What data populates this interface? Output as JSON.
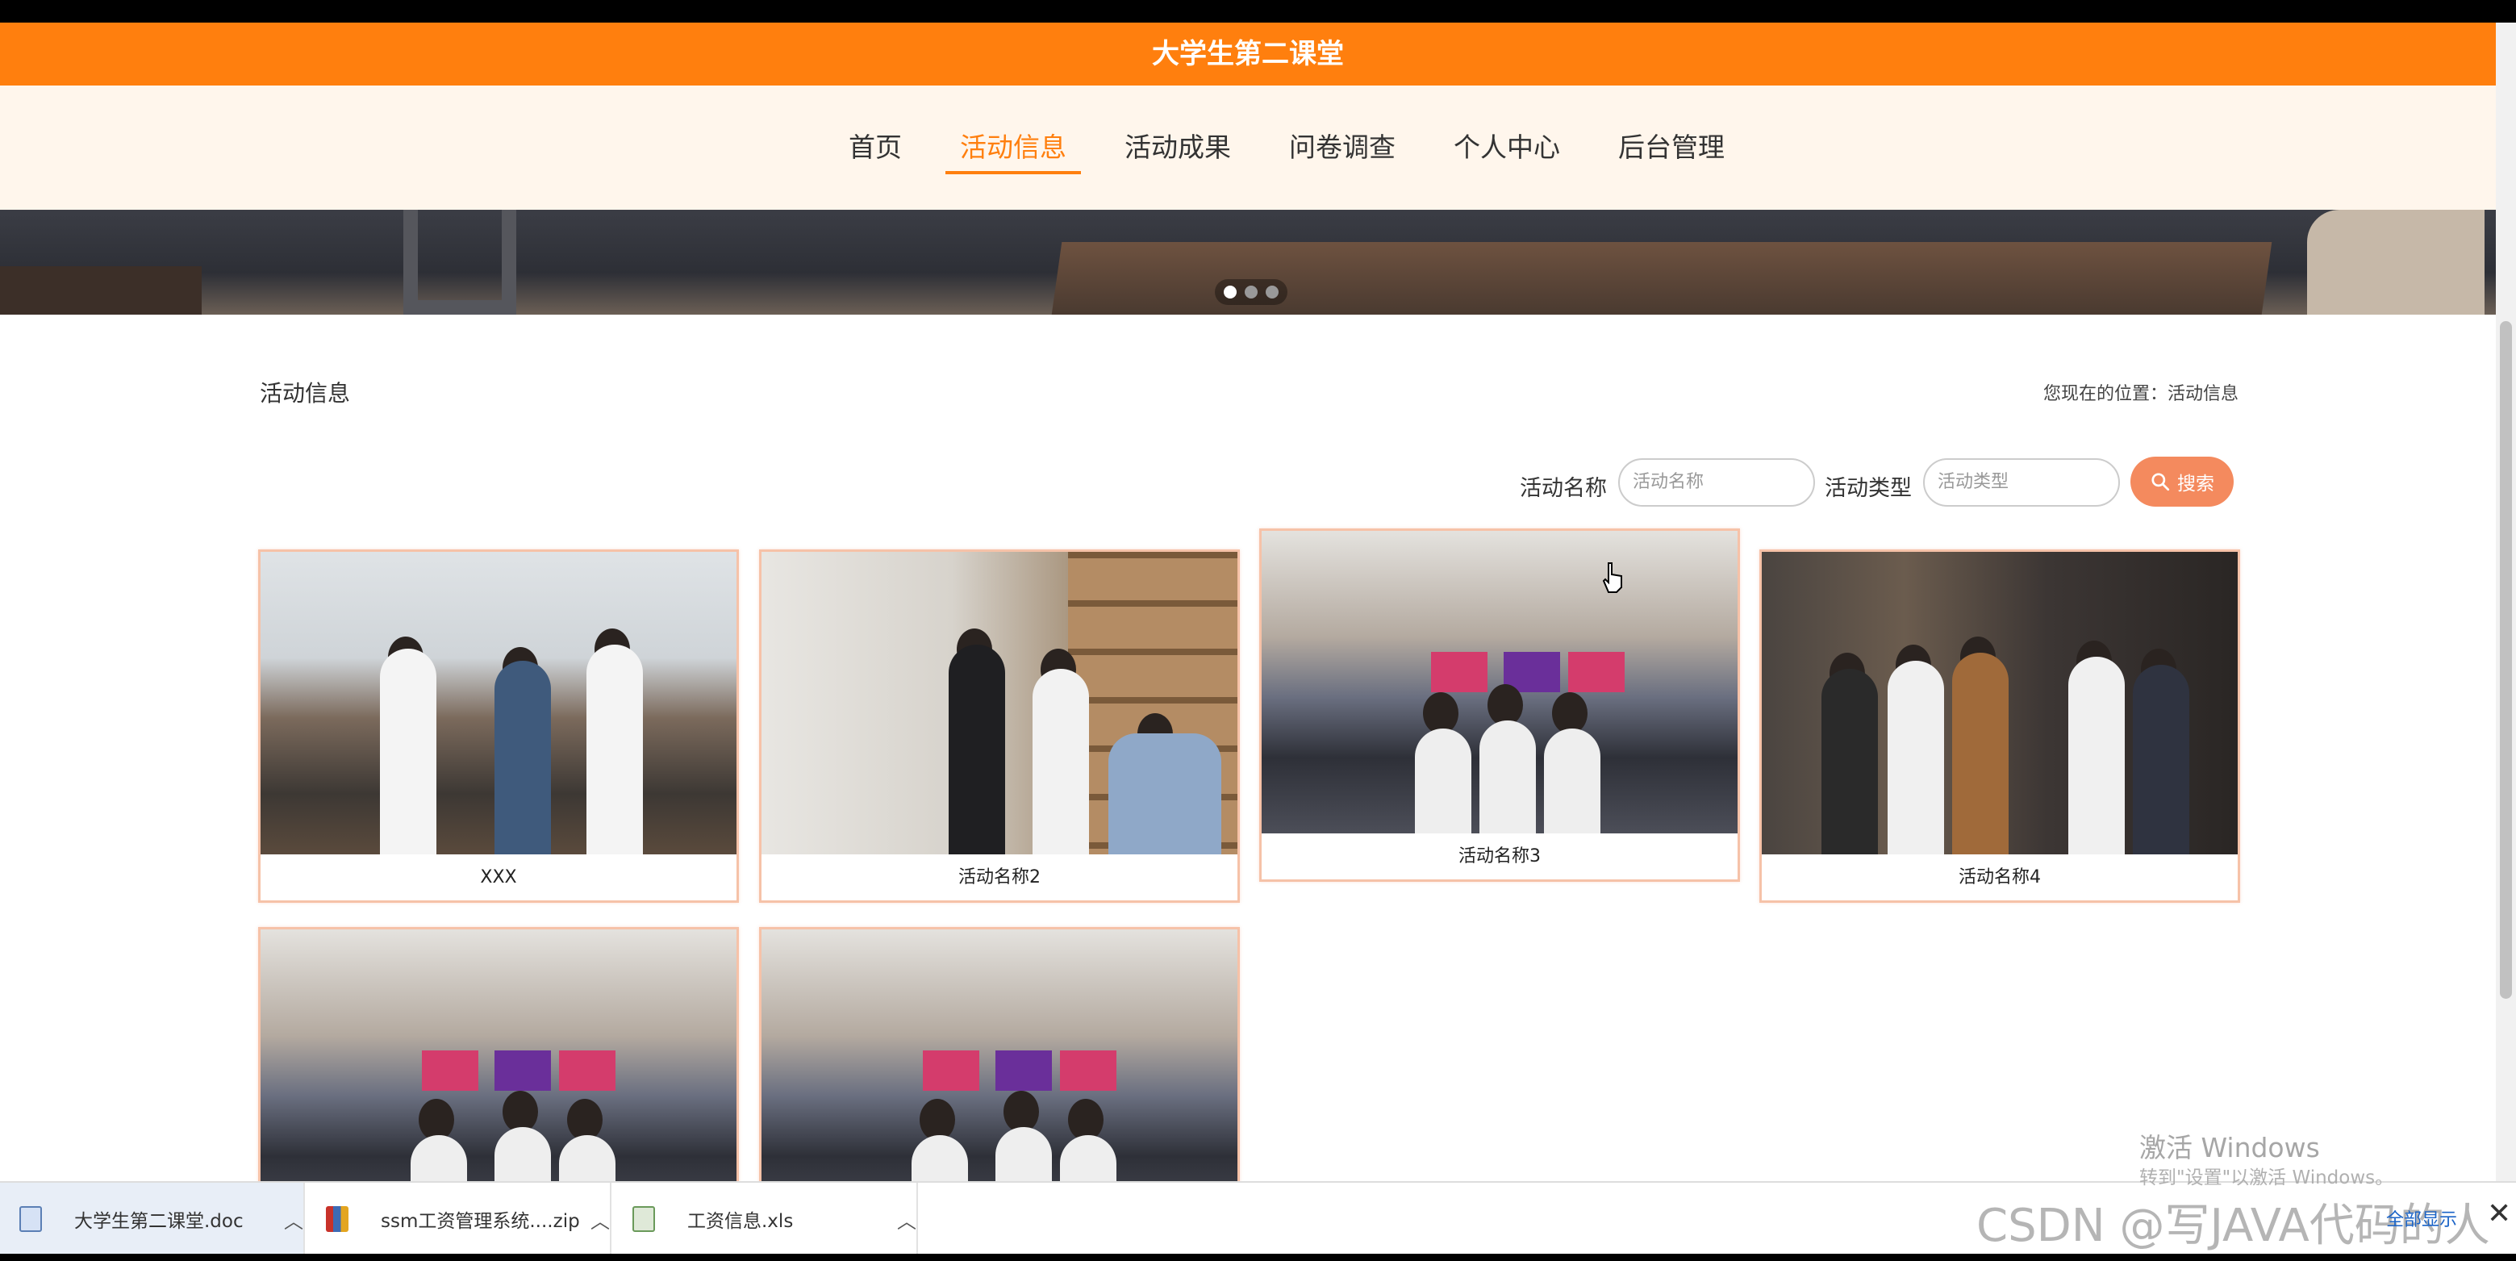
{
  "site": {
    "title": "大学生第二课堂"
  },
  "nav": {
    "items": [
      "首页",
      "活动信息",
      "活动成果",
      "问卷调查",
      "个人中心",
      "后台管理"
    ],
    "active_index": 1
  },
  "banner": {
    "slides": 3,
    "active_slide": 0
  },
  "section": {
    "title": "活动信息",
    "breadcrumb": "您现在的位置：活动信息"
  },
  "search": {
    "name_label": "活动名称",
    "name_placeholder": "活动名称",
    "type_label": "活动类型",
    "type_placeholder": "活动类型",
    "button_label": "搜索"
  },
  "cards": [
    {
      "title": "XXX"
    },
    {
      "title": "活动名称2"
    },
    {
      "title": "活动名称3"
    },
    {
      "title": "活动名称4"
    },
    {
      "title": ""
    },
    {
      "title": ""
    }
  ],
  "downloads": [
    {
      "name": "大学生第二课堂.doc",
      "icon": "doc-icon"
    },
    {
      "name": "ssm工资管理系统....zip",
      "icon": "zip-icon"
    },
    {
      "name": "工资信息.xls",
      "icon": "xls-icon"
    }
  ],
  "downloads_bar": {
    "show_all": "全部显示"
  },
  "overlay": {
    "activate_title": "激活 Windows",
    "activate_hint": "转到\"设置\"以激活 Windows。",
    "csdn_watermark": "CSDN @写JAVA代码的人"
  },
  "colors": {
    "accent": "#ff7f0e",
    "search_button": "#f48a5e",
    "nav_bg": "#fff6ec"
  }
}
